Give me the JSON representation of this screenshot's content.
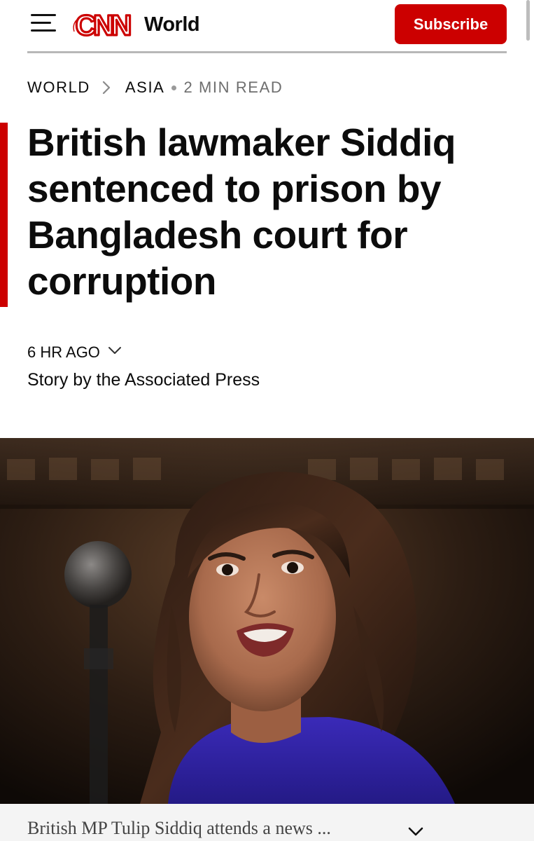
{
  "header": {
    "logo_text": "CNN",
    "section": "World",
    "subscribe_label": "Subscribe",
    "brand_color": "#cc0000"
  },
  "breadcrumb": {
    "items": [
      "WORLD",
      "ASIA"
    ],
    "read_time": "2 MIN READ"
  },
  "article": {
    "headline": "British lawmaker Siddiq sentenced to prison by Bangladesh court for corruption",
    "timestamp": "6 HR AGO",
    "byline": "Story by the Associated Press"
  },
  "photo": {
    "caption": "British MP Tulip Siddiq attends a news ..."
  },
  "icons": {
    "menu": "hamburger-menu-icon",
    "breadcrumb_separator": "chevron-right-icon",
    "timestamp_expand": "chevron-down-icon",
    "caption_expand": "chevron-down-icon"
  }
}
